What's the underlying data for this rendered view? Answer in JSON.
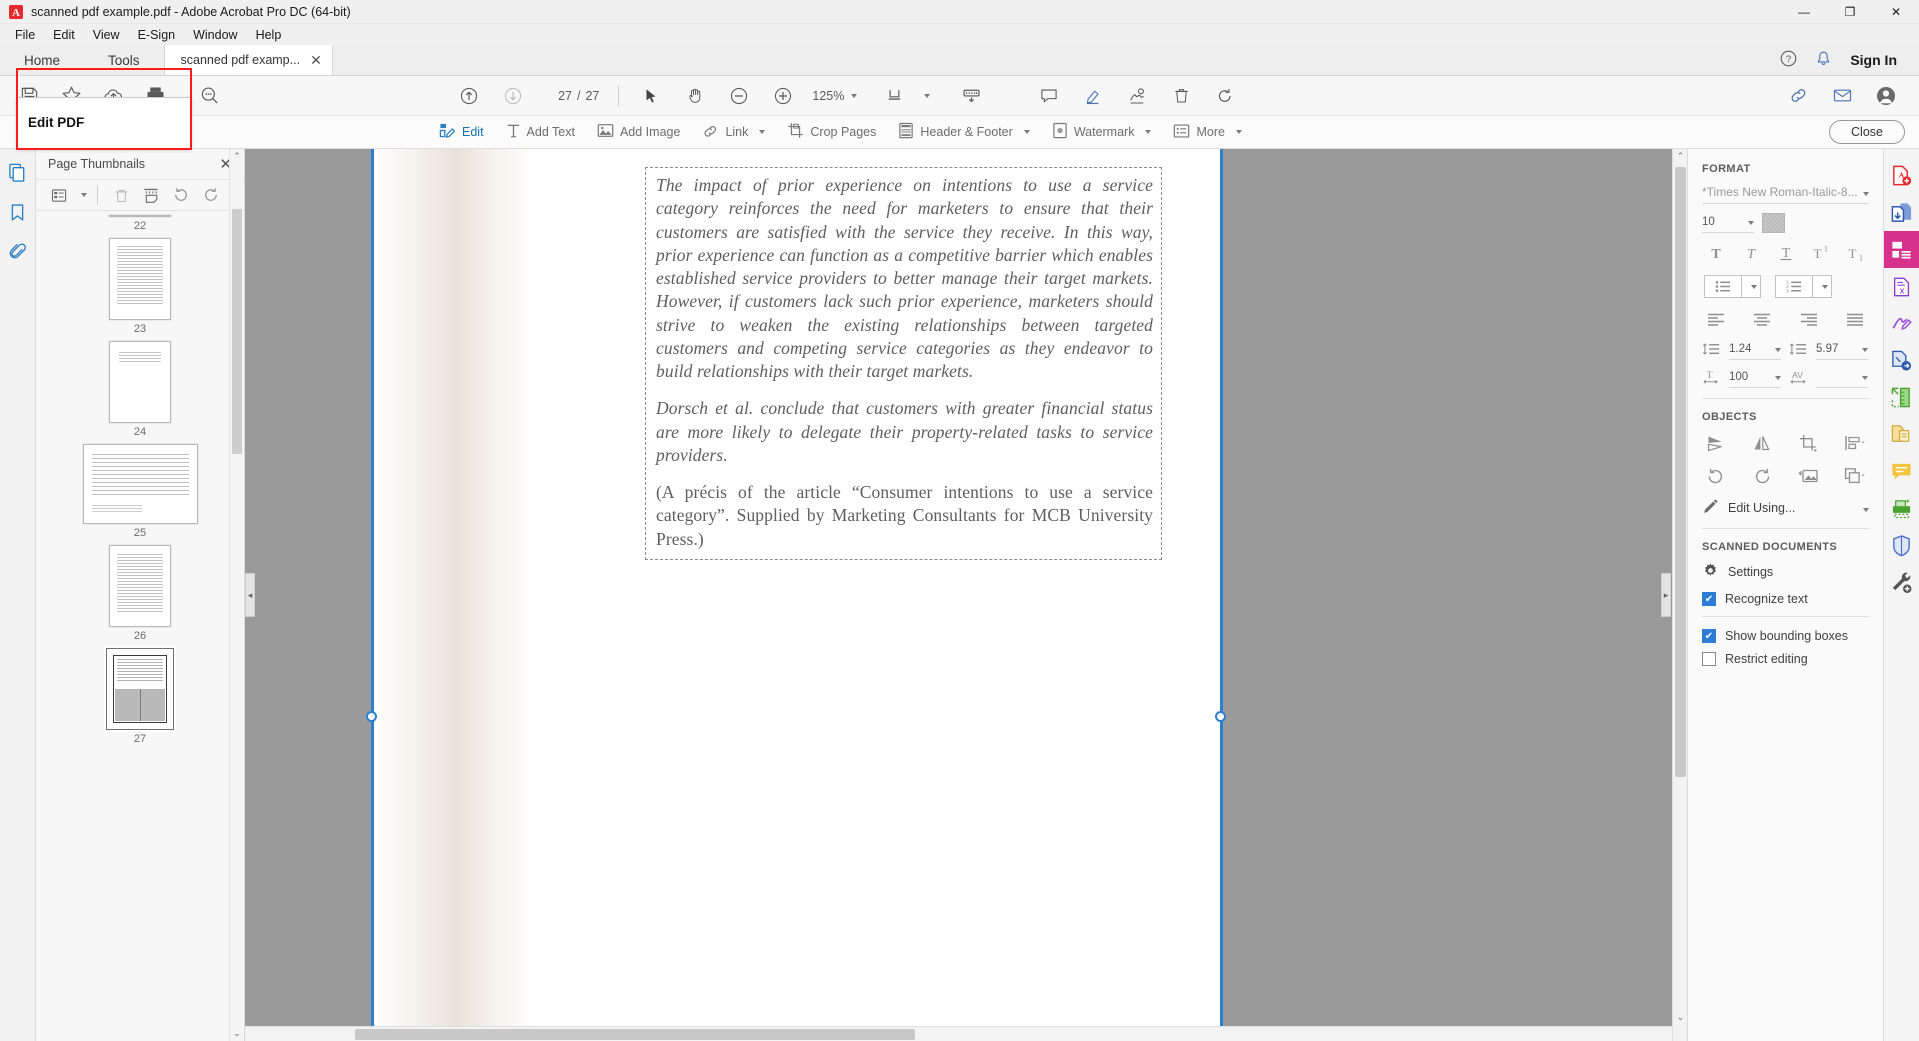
{
  "window": {
    "title": "scanned pdf example.pdf - Adobe Acrobat Pro DC (64-bit)",
    "minimize": "—",
    "maximize": "❐",
    "close": "✕"
  },
  "menubar": {
    "items": [
      "File",
      "Edit",
      "View",
      "E-Sign",
      "Window",
      "Help"
    ]
  },
  "tabstrip": {
    "home": "Home",
    "tools": "Tools",
    "doc_tab": "scanned pdf examp...",
    "doc_tab_close": "✕",
    "sign_in": "Sign In"
  },
  "quick_toolbar": {
    "save": "save-icon",
    "star": "add-to-favorites-icon",
    "upload": "upload-to-cloud-icon",
    "print": "print-icon",
    "search": "search-icon"
  },
  "tooltip": {
    "label": "Edit PDF"
  },
  "main_toolbar": {
    "prev_page": "previous-page-icon",
    "next_page": "next-page-icon",
    "current_page": "27",
    "page_separator": "/",
    "total_pages": "27",
    "select_tool": "select-cursor-icon",
    "hand_tool": "hand-icon",
    "zoom_out": "zoom-out-icon",
    "zoom_in": "zoom-in-icon",
    "zoom_level": "125%",
    "fit_page": "page-fit-icon",
    "scroll_mode": "scroll-mode-icon",
    "comment": "comment-icon",
    "highlight": "highlight-marker-icon",
    "fill_sign": "fill-and-sign-icon",
    "delete": "delete-icon",
    "rotate": "rotate-icon",
    "share_link": "share-link-icon",
    "email": "email-icon",
    "account": "account-icon"
  },
  "edit_toolbar": {
    "items": [
      {
        "label": "Edit",
        "icon": "edit-icon",
        "active": true,
        "dropdown": false
      },
      {
        "label": "Add Text",
        "icon": "add-text-icon",
        "active": false,
        "dropdown": false
      },
      {
        "label": "Add Image",
        "icon": "add-image-icon",
        "active": false,
        "dropdown": false
      },
      {
        "label": "Link",
        "icon": "link-icon",
        "active": false,
        "dropdown": true
      },
      {
        "label": "Crop Pages",
        "icon": "crop-pages-icon",
        "active": false,
        "dropdown": false
      },
      {
        "label": "Header & Footer",
        "icon": "header-footer-icon",
        "active": false,
        "dropdown": true
      },
      {
        "label": "Watermark",
        "icon": "watermark-icon",
        "active": false,
        "dropdown": true
      },
      {
        "label": "More",
        "icon": "more-icon",
        "active": false,
        "dropdown": true
      }
    ],
    "close_button": "Close"
  },
  "left_rail": {
    "items": [
      "page-thumbnails-icon",
      "bookmarks-icon",
      "attachments-icon"
    ]
  },
  "thumbnails_panel": {
    "title": "Page Thumbnails",
    "close": "✕",
    "tools": [
      "thumbnail-size-options-icon",
      "delete-pages-icon",
      "extract-pages-icon",
      "rotate-counterclockwise-icon",
      "rotate-clockwise-icon"
    ],
    "pages": [
      {
        "number": "22",
        "selected": false
      },
      {
        "number": "23",
        "selected": false
      },
      {
        "number": "24",
        "selected": false
      },
      {
        "number": "25",
        "selected": false
      },
      {
        "number": "26",
        "selected": false
      },
      {
        "number": "27",
        "selected": true
      }
    ],
    "scroll_up": "⌃",
    "scroll_down": "⌄"
  },
  "document": {
    "paragraphs": [
      "The impact of prior experience on intentions to use a service category reinforces the need for marketers to ensure that their customers are satisfied with the service they receive. In this way, prior experience can function as a competitive barrier which enables established service providers to better manage their target markets. However, if customers lack such prior experience, marketers should strive to weaken the existing relationships between targeted customers and competing service categories as they endeavor to build relationships with their target markets.",
      "Dorsch et al. conclude that customers with greater financial status are more likely to delegate their property-related tasks to service providers.",
      "(A précis of the article “Consumer intentions to use a service category”. Supplied by Marketing Consultants for MCB University Press.)"
    ],
    "collapse_left": "◂",
    "collapse_right": "▸"
  },
  "format_panel": {
    "section_format": "FORMAT",
    "font_name": "*Times New Roman-Italic-8...",
    "font_size": "10",
    "font_color": "#c2c2c2",
    "text_style_buttons": [
      "bold-icon",
      "italic-icon",
      "underline-icon",
      "superscript-icon",
      "subscript-icon"
    ],
    "list_buttons": [
      "bulleted-list-icon",
      "numbered-list-icon"
    ],
    "align_buttons": [
      "align-left-icon",
      "align-center-icon",
      "align-right-icon",
      "align-justify-icon"
    ],
    "line_spacing_icon": "line-spacing-icon",
    "line_spacing": "1.24",
    "paragraph_spacing_icon": "paragraph-spacing-icon",
    "paragraph_spacing": "5.97",
    "horizontal_scale_icon": "horizontal-scale-icon",
    "horizontal_scale": "100",
    "character_spacing_icon": "character-spacing-icon",
    "character_spacing": "",
    "section_objects": "OBJECTS",
    "object_buttons_row1": [
      "flip-vertical-icon",
      "flip-horizontal-icon",
      "crop-image-icon",
      "align-objects-icon"
    ],
    "object_buttons_row2": [
      "rotate-counterclockwise-icon",
      "rotate-clockwise-icon",
      "replace-image-icon",
      "arrange-objects-icon"
    ],
    "edit_using_icon": "pencil-icon",
    "edit_using": "Edit Using...",
    "section_scanned": "SCANNED DOCUMENTS",
    "settings_icon": "gear-icon",
    "settings": "Settings",
    "recognize_text": "Recognize text",
    "recognize_text_checked": true,
    "show_bounding_boxes": "Show bounding boxes",
    "show_bounding_boxes_checked": true,
    "restrict_editing": "Restrict editing",
    "restrict_editing_checked": false,
    "check_glyph": "✔"
  },
  "right_rail": {
    "items": [
      "create-pdf-icon",
      "combine-files-icon",
      "edit-pdf-icon",
      "export-pdf-icon",
      "fill-and-sign-icon",
      "send-for-signature-icon",
      "measure-icon",
      "organize-pages-icon",
      "comment-icon",
      "enhance-scans-icon",
      "protect-icon",
      "more-tools-icon"
    ],
    "active_index": 2,
    "accent": "#d8318c"
  }
}
